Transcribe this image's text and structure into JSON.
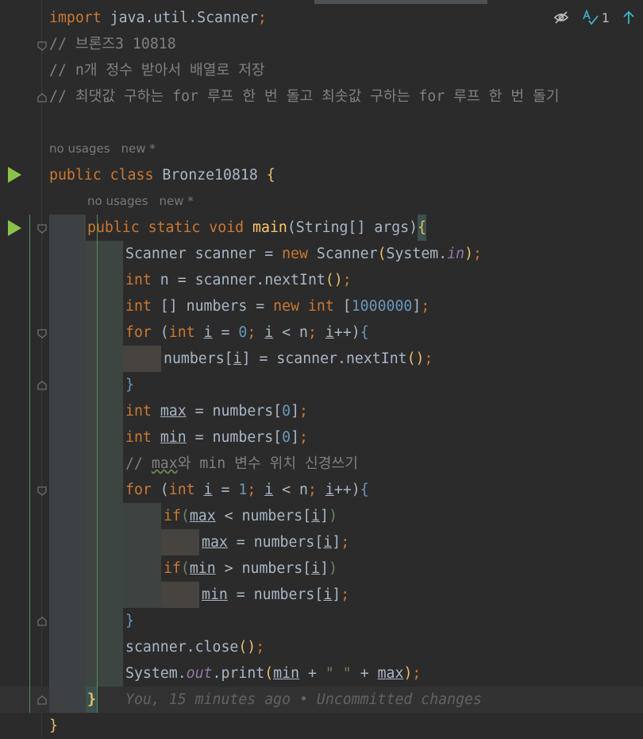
{
  "editor": {
    "file_class": "Bronze10818",
    "lines": {
      "l1_kw": "import",
      "l1_rest": " java.util.Scanner",
      "l1_semi": ";",
      "c1": "// 브론즈3 10818",
      "c2": "// n개 정수 받아서 배열로 저장",
      "c3": "// 최댓값 구하는 for 루프 한 번 돌고 최솟값 구하는 for 루프 한 번 돌기",
      "c4_pre": "// ",
      "c4_max": "max",
      "c4_post": "와 min 변수 위치 신경쓰기"
    },
    "hints": {
      "usages": "no usages",
      "author": "new *"
    },
    "blame": "You, 15 minutes ago • Uncommitted changes"
  },
  "toolbar": {
    "inspection_count": "1",
    "hide_icon": "eye-crossed-icon",
    "spell_icon": "spellcheck-icon",
    "up_icon": "arrow-up-icon"
  },
  "colors": {
    "background": "#2b2b2b",
    "keyword": "#cc7832",
    "comment": "#808080",
    "number": "#6897bb",
    "string": "#6a8759",
    "field": "#9876aa",
    "method": "#ffc66d",
    "run": "#8bc34a"
  }
}
